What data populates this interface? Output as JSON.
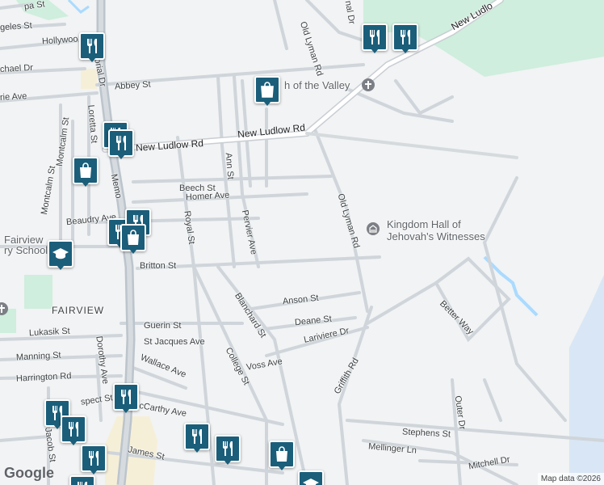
{
  "map": {
    "attribution": "Map data ©2026",
    "brand": "Google",
    "colors": {
      "background": "#f1f3f4",
      "park": "#cfeedd",
      "water": "#aadaff",
      "road": "#ffffff",
      "road_edge": "#c7cdd3",
      "pin": "#1a5e7a",
      "highway": "#bcc4cc"
    }
  },
  "labels": {
    "new_ludlow_rd_ne": "New Ludlo",
    "new_ludlow_rd_mid": "New Ludlow Rd",
    "new_ludlow_rd_w": "New Ludlow Rd",
    "old_lyman_rd_n": "Old Lyman Rd",
    "old_lyman_rd_s": "Old Lyman Rd",
    "memorial_dr_n": "morial Dr",
    "memorial_dr_s": "Memo",
    "hollywood": "Hollywoo",
    "angeles_st": "geles St",
    "pa_st": "pa St",
    "michael_dr": "chael Dr",
    "abbey_st": "Abbey St",
    "rie_ave": "rie Ave",
    "loretta_st": "Loretta St",
    "montcalm_st_1": "Montcalm St",
    "montcalm_st_2": "Montcalm St",
    "beech_st": "Beech St",
    "homer_ave": "Homer Ave",
    "ann_st": "Ann St",
    "pervier_ave": "Pervier Ave",
    "royal_st": "Royal St",
    "beaudry_ave": "Beaudry Ave",
    "britton_st": "Britton St",
    "anson_st": "Anson St",
    "deane_st": "Deane St",
    "lariviere_dr": "Lariviere Dr",
    "blanchard_st": "Blanchard St",
    "guerin_st": "Guerin St",
    "st_jacques_ave": "St Jacques Ave",
    "lukasik_st": "Lukasik St",
    "manning_st": "Manning St",
    "wallace_ave": "Wallace Ave",
    "harrington_rd": "Harrington Rd",
    "dorothy_ave": "Dorothy Ave",
    "college_st": "College St",
    "voss_ave": "Voss Ave",
    "griffith_rd": "Griffith Rd",
    "better_way": "Better Way",
    "outer_dr": "Outer Dr",
    "stephens_st": "Stephens St",
    "mellinger_ln": "Mellinger Ln",
    "mitchell_dr": "Mitchell Dr",
    "mccarthy_ave": "cCarthy Ave",
    "prospect_st": "spect St",
    "james_st": "James St",
    "jacob_st": "Jacob St",
    "nal_dr": "nal Dr",
    "fairview": "FAIRVIEW",
    "fairview_school_1": "Fairview",
    "fairview_school_2": "ry School",
    "church": "h of the Valley",
    "kingdom_hall_1": "Kingdom Hall of",
    "kingdom_hall_2": "Jehovah's Witnesses"
  },
  "pins": [
    {
      "name": "restaurant-pin",
      "icon": "fork-knife-icon"
    },
    {
      "name": "shopping-pin",
      "icon": "shopping-bag-icon"
    },
    {
      "name": "school-pin",
      "icon": "graduation-cap-icon"
    }
  ]
}
